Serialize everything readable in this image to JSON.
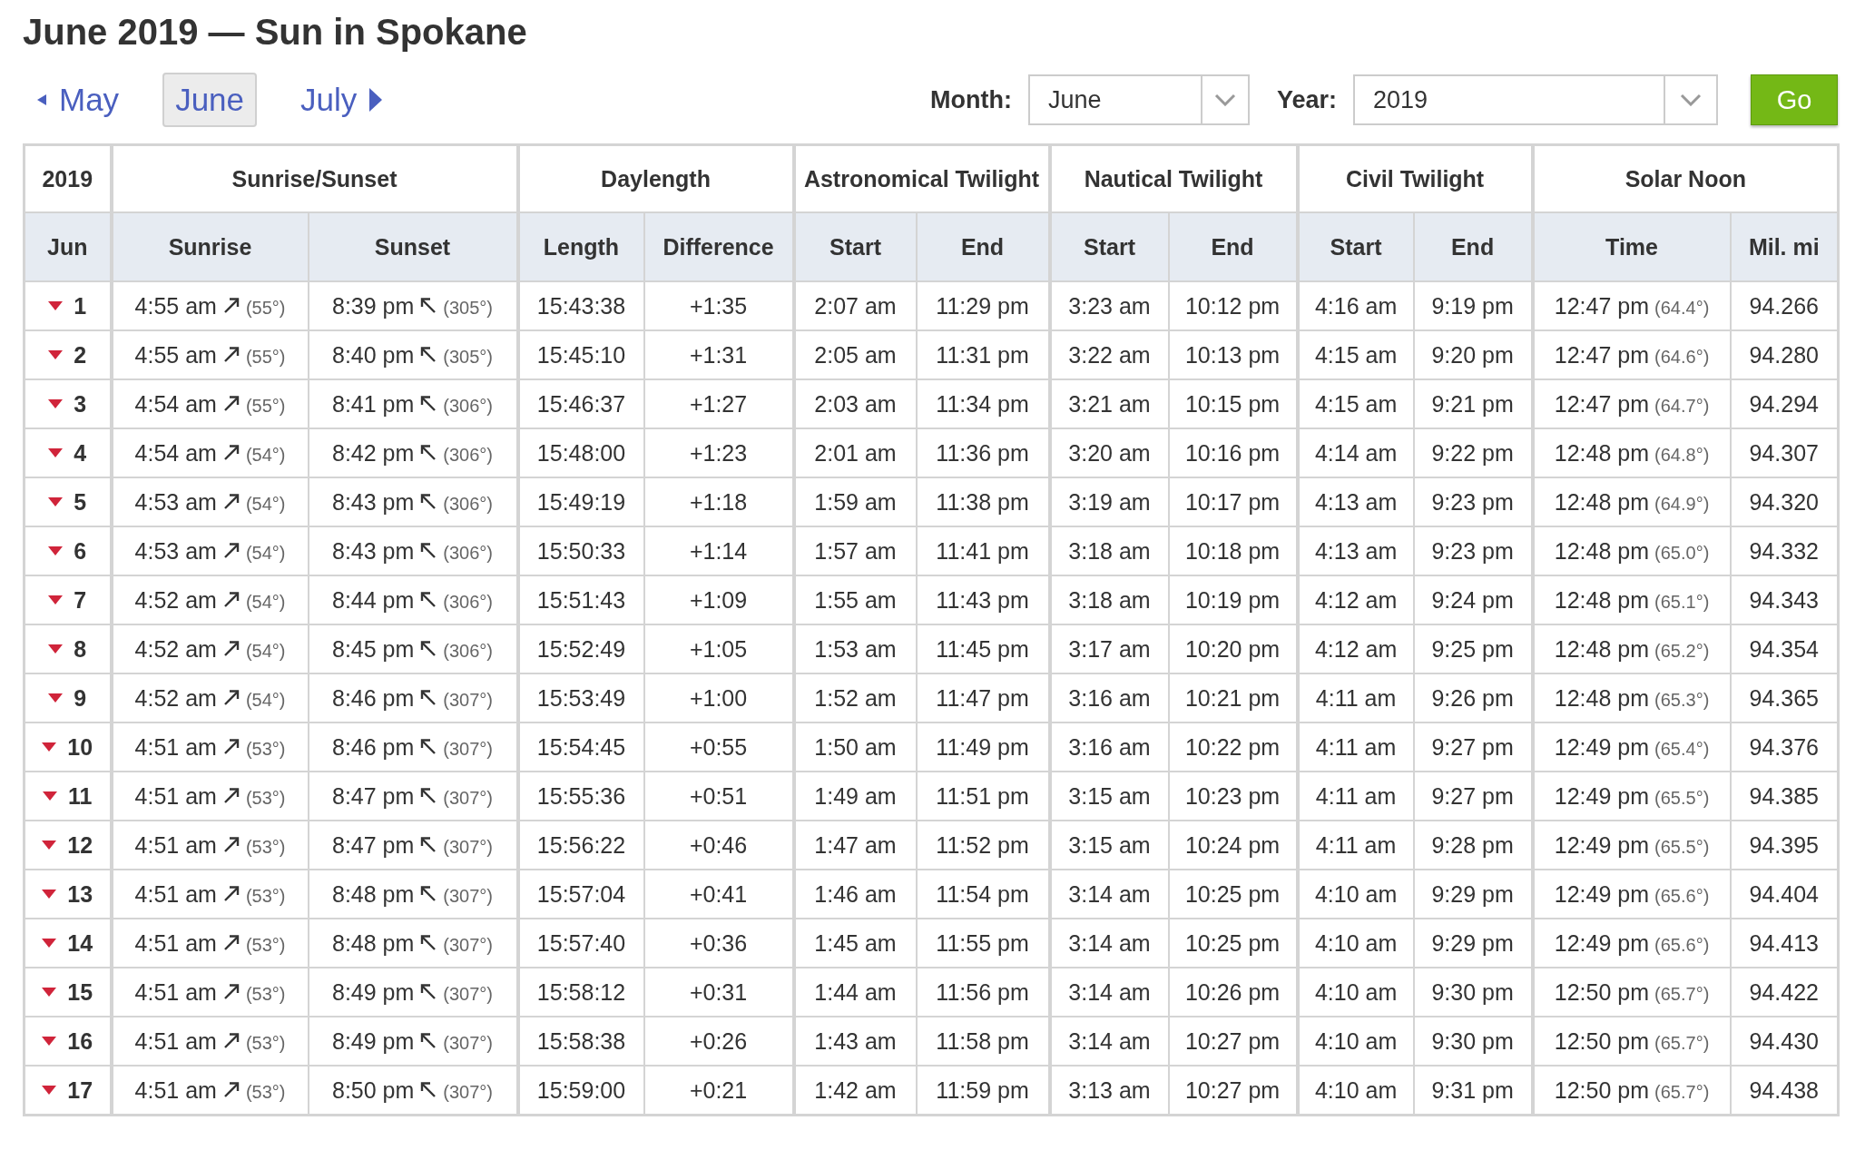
{
  "title": "June 2019 — Sun in Spokane",
  "month_nav": [
    {
      "label": "May",
      "kind": "prev",
      "selected": false
    },
    {
      "label": "June",
      "kind": "current",
      "selected": true
    },
    {
      "label": "July",
      "kind": "next",
      "selected": false
    }
  ],
  "form": {
    "month_label": "Month:",
    "month_value": "June",
    "year_label": "Year:",
    "year_value": "2019",
    "submit": "Go"
  },
  "table": {
    "header_groups": [
      {
        "label": "2019",
        "columns": [
          "Jun"
        ]
      },
      {
        "label": "Sunrise/Sunset",
        "columns": [
          "Sunrise",
          "Sunset"
        ]
      },
      {
        "label": "Daylength",
        "columns": [
          "Length",
          "Difference"
        ]
      },
      {
        "label": "Astronomical Twilight",
        "columns": [
          "Start",
          "End"
        ]
      },
      {
        "label": "Nautical Twilight",
        "columns": [
          "Start",
          "End"
        ]
      },
      {
        "label": "Civil Twilight",
        "columns": [
          "Start",
          "End"
        ]
      },
      {
        "label": "Solar Noon",
        "columns": [
          "Time",
          "Mil. mi"
        ]
      }
    ],
    "rows": [
      {
        "day": "1",
        "sunrise": "4:55 am",
        "sunrise_angle": "(55°)",
        "sunset": "8:39 pm",
        "sunset_angle": "(305°)",
        "length": "15:43:38",
        "difference": "+1:35",
        "astro_start": "2:07 am",
        "astro_end": "11:29 pm",
        "nautical_start": "3:23 am",
        "nautical_end": "10:12 pm",
        "civil_start": "4:16 am",
        "civil_end": "9:19 pm",
        "noon_time": "12:47 pm",
        "noon_altitude": "(64.4°)",
        "distance": "94.266"
      },
      {
        "day": "2",
        "sunrise": "4:55 am",
        "sunrise_angle": "(55°)",
        "sunset": "8:40 pm",
        "sunset_angle": "(305°)",
        "length": "15:45:10",
        "difference": "+1:31",
        "astro_start": "2:05 am",
        "astro_end": "11:31 pm",
        "nautical_start": "3:22 am",
        "nautical_end": "10:13 pm",
        "civil_start": "4:15 am",
        "civil_end": "9:20 pm",
        "noon_time": "12:47 pm",
        "noon_altitude": "(64.6°)",
        "distance": "94.280"
      },
      {
        "day": "3",
        "sunrise": "4:54 am",
        "sunrise_angle": "(55°)",
        "sunset": "8:41 pm",
        "sunset_angle": "(306°)",
        "length": "15:46:37",
        "difference": "+1:27",
        "astro_start": "2:03 am",
        "astro_end": "11:34 pm",
        "nautical_start": "3:21 am",
        "nautical_end": "10:15 pm",
        "civil_start": "4:15 am",
        "civil_end": "9:21 pm",
        "noon_time": "12:47 pm",
        "noon_altitude": "(64.7°)",
        "distance": "94.294"
      },
      {
        "day": "4",
        "sunrise": "4:54 am",
        "sunrise_angle": "(54°)",
        "sunset": "8:42 pm",
        "sunset_angle": "(306°)",
        "length": "15:48:00",
        "difference": "+1:23",
        "astro_start": "2:01 am",
        "astro_end": "11:36 pm",
        "nautical_start": "3:20 am",
        "nautical_end": "10:16 pm",
        "civil_start": "4:14 am",
        "civil_end": "9:22 pm",
        "noon_time": "12:48 pm",
        "noon_altitude": "(64.8°)",
        "distance": "94.307"
      },
      {
        "day": "5",
        "sunrise": "4:53 am",
        "sunrise_angle": "(54°)",
        "sunset": "8:43 pm",
        "sunset_angle": "(306°)",
        "length": "15:49:19",
        "difference": "+1:18",
        "astro_start": "1:59 am",
        "astro_end": "11:38 pm",
        "nautical_start": "3:19 am",
        "nautical_end": "10:17 pm",
        "civil_start": "4:13 am",
        "civil_end": "9:23 pm",
        "noon_time": "12:48 pm",
        "noon_altitude": "(64.9°)",
        "distance": "94.320"
      },
      {
        "day": "6",
        "sunrise": "4:53 am",
        "sunrise_angle": "(54°)",
        "sunset": "8:43 pm",
        "sunset_angle": "(306°)",
        "length": "15:50:33",
        "difference": "+1:14",
        "astro_start": "1:57 am",
        "astro_end": "11:41 pm",
        "nautical_start": "3:18 am",
        "nautical_end": "10:18 pm",
        "civil_start": "4:13 am",
        "civil_end": "9:23 pm",
        "noon_time": "12:48 pm",
        "noon_altitude": "(65.0°)",
        "distance": "94.332"
      },
      {
        "day": "7",
        "sunrise": "4:52 am",
        "sunrise_angle": "(54°)",
        "sunset": "8:44 pm",
        "sunset_angle": "(306°)",
        "length": "15:51:43",
        "difference": "+1:09",
        "astro_start": "1:55 am",
        "astro_end": "11:43 pm",
        "nautical_start": "3:18 am",
        "nautical_end": "10:19 pm",
        "civil_start": "4:12 am",
        "civil_end": "9:24 pm",
        "noon_time": "12:48 pm",
        "noon_altitude": "(65.1°)",
        "distance": "94.343"
      },
      {
        "day": "8",
        "sunrise": "4:52 am",
        "sunrise_angle": "(54°)",
        "sunset": "8:45 pm",
        "sunset_angle": "(306°)",
        "length": "15:52:49",
        "difference": "+1:05",
        "astro_start": "1:53 am",
        "astro_end": "11:45 pm",
        "nautical_start": "3:17 am",
        "nautical_end": "10:20 pm",
        "civil_start": "4:12 am",
        "civil_end": "9:25 pm",
        "noon_time": "12:48 pm",
        "noon_altitude": "(65.2°)",
        "distance": "94.354"
      },
      {
        "day": "9",
        "sunrise": "4:52 am",
        "sunrise_angle": "(54°)",
        "sunset": "8:46 pm",
        "sunset_angle": "(307°)",
        "length": "15:53:49",
        "difference": "+1:00",
        "astro_start": "1:52 am",
        "astro_end": "11:47 pm",
        "nautical_start": "3:16 am",
        "nautical_end": "10:21 pm",
        "civil_start": "4:11 am",
        "civil_end": "9:26 pm",
        "noon_time": "12:48 pm",
        "noon_altitude": "(65.3°)",
        "distance": "94.365"
      },
      {
        "day": "10",
        "sunrise": "4:51 am",
        "sunrise_angle": "(53°)",
        "sunset": "8:46 pm",
        "sunset_angle": "(307°)",
        "length": "15:54:45",
        "difference": "+0:55",
        "astro_start": "1:50 am",
        "astro_end": "11:49 pm",
        "nautical_start": "3:16 am",
        "nautical_end": "10:22 pm",
        "civil_start": "4:11 am",
        "civil_end": "9:27 pm",
        "noon_time": "12:49 pm",
        "noon_altitude": "(65.4°)",
        "distance": "94.376"
      },
      {
        "day": "11",
        "sunrise": "4:51 am",
        "sunrise_angle": "(53°)",
        "sunset": "8:47 pm",
        "sunset_angle": "(307°)",
        "length": "15:55:36",
        "difference": "+0:51",
        "astro_start": "1:49 am",
        "astro_end": "11:51 pm",
        "nautical_start": "3:15 am",
        "nautical_end": "10:23 pm",
        "civil_start": "4:11 am",
        "civil_end": "9:27 pm",
        "noon_time": "12:49 pm",
        "noon_altitude": "(65.5°)",
        "distance": "94.385"
      },
      {
        "day": "12",
        "sunrise": "4:51 am",
        "sunrise_angle": "(53°)",
        "sunset": "8:47 pm",
        "sunset_angle": "(307°)",
        "length": "15:56:22",
        "difference": "+0:46",
        "astro_start": "1:47 am",
        "astro_end": "11:52 pm",
        "nautical_start": "3:15 am",
        "nautical_end": "10:24 pm",
        "civil_start": "4:11 am",
        "civil_end": "9:28 pm",
        "noon_time": "12:49 pm",
        "noon_altitude": "(65.5°)",
        "distance": "94.395"
      },
      {
        "day": "13",
        "sunrise": "4:51 am",
        "sunrise_angle": "(53°)",
        "sunset": "8:48 pm",
        "sunset_angle": "(307°)",
        "length": "15:57:04",
        "difference": "+0:41",
        "astro_start": "1:46 am",
        "astro_end": "11:54 pm",
        "nautical_start": "3:14 am",
        "nautical_end": "10:25 pm",
        "civil_start": "4:10 am",
        "civil_end": "9:29 pm",
        "noon_time": "12:49 pm",
        "noon_altitude": "(65.6°)",
        "distance": "94.404"
      },
      {
        "day": "14",
        "sunrise": "4:51 am",
        "sunrise_angle": "(53°)",
        "sunset": "8:48 pm",
        "sunset_angle": "(307°)",
        "length": "15:57:40",
        "difference": "+0:36",
        "astro_start": "1:45 am",
        "astro_end": "11:55 pm",
        "nautical_start": "3:14 am",
        "nautical_end": "10:25 pm",
        "civil_start": "4:10 am",
        "civil_end": "9:29 pm",
        "noon_time": "12:49 pm",
        "noon_altitude": "(65.6°)",
        "distance": "94.413"
      },
      {
        "day": "15",
        "sunrise": "4:51 am",
        "sunrise_angle": "(53°)",
        "sunset": "8:49 pm",
        "sunset_angle": "(307°)",
        "length": "15:58:12",
        "difference": "+0:31",
        "astro_start": "1:44 am",
        "astro_end": "11:56 pm",
        "nautical_start": "3:14 am",
        "nautical_end": "10:26 pm",
        "civil_start": "4:10 am",
        "civil_end": "9:30 pm",
        "noon_time": "12:50 pm",
        "noon_altitude": "(65.7°)",
        "distance": "94.422"
      },
      {
        "day": "16",
        "sunrise": "4:51 am",
        "sunrise_angle": "(53°)",
        "sunset": "8:49 pm",
        "sunset_angle": "(307°)",
        "length": "15:58:38",
        "difference": "+0:26",
        "astro_start": "1:43 am",
        "astro_end": "11:58 pm",
        "nautical_start": "3:14 am",
        "nautical_end": "10:27 pm",
        "civil_start": "4:10 am",
        "civil_end": "9:30 pm",
        "noon_time": "12:50 pm",
        "noon_altitude": "(65.7°)",
        "distance": "94.430"
      },
      {
        "day": "17",
        "sunrise": "4:51 am",
        "sunrise_angle": "(53°)",
        "sunset": "8:50 pm",
        "sunset_angle": "(307°)",
        "length": "15:59:00",
        "difference": "+0:21",
        "astro_start": "1:42 am",
        "astro_end": "11:59 pm",
        "nautical_start": "3:13 am",
        "nautical_end": "10:27 pm",
        "civil_start": "4:10 am",
        "civil_end": "9:31 pm",
        "noon_time": "12:50 pm",
        "noon_altitude": "(65.7°)",
        "distance": "94.438"
      }
    ]
  }
}
